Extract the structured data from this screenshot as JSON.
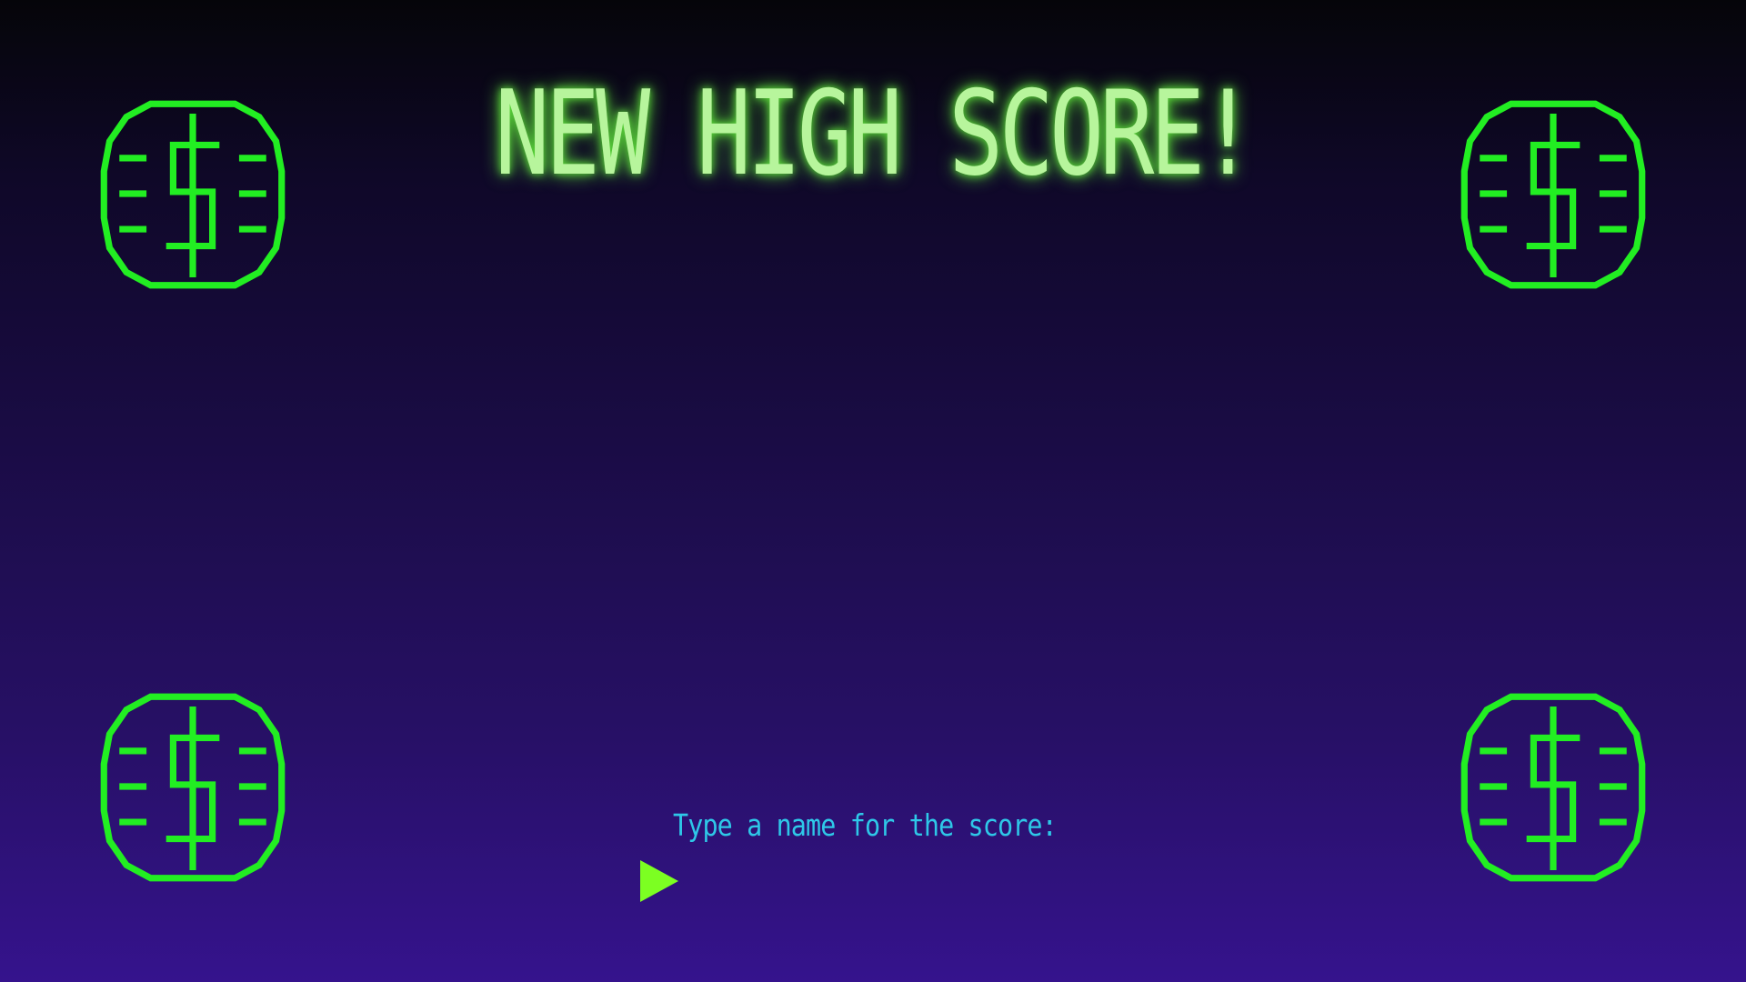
{
  "screen": {
    "title": "NEW HIGH SCORE!",
    "prompt": "Type a name for the score:",
    "name_input": {
      "value": "",
      "placeholder": ""
    }
  },
  "icons": {
    "coin": "dollar-coin-icon",
    "cursor": "triangle-right-icon"
  },
  "colors": {
    "title": "#b7f59c",
    "title_glow": "#5ddf3a",
    "coin": "#22ee22",
    "prompt": "#2ec8e8",
    "cursor": "#7cff22",
    "background_top": "#050509",
    "background_bottom": "#35138d"
  }
}
